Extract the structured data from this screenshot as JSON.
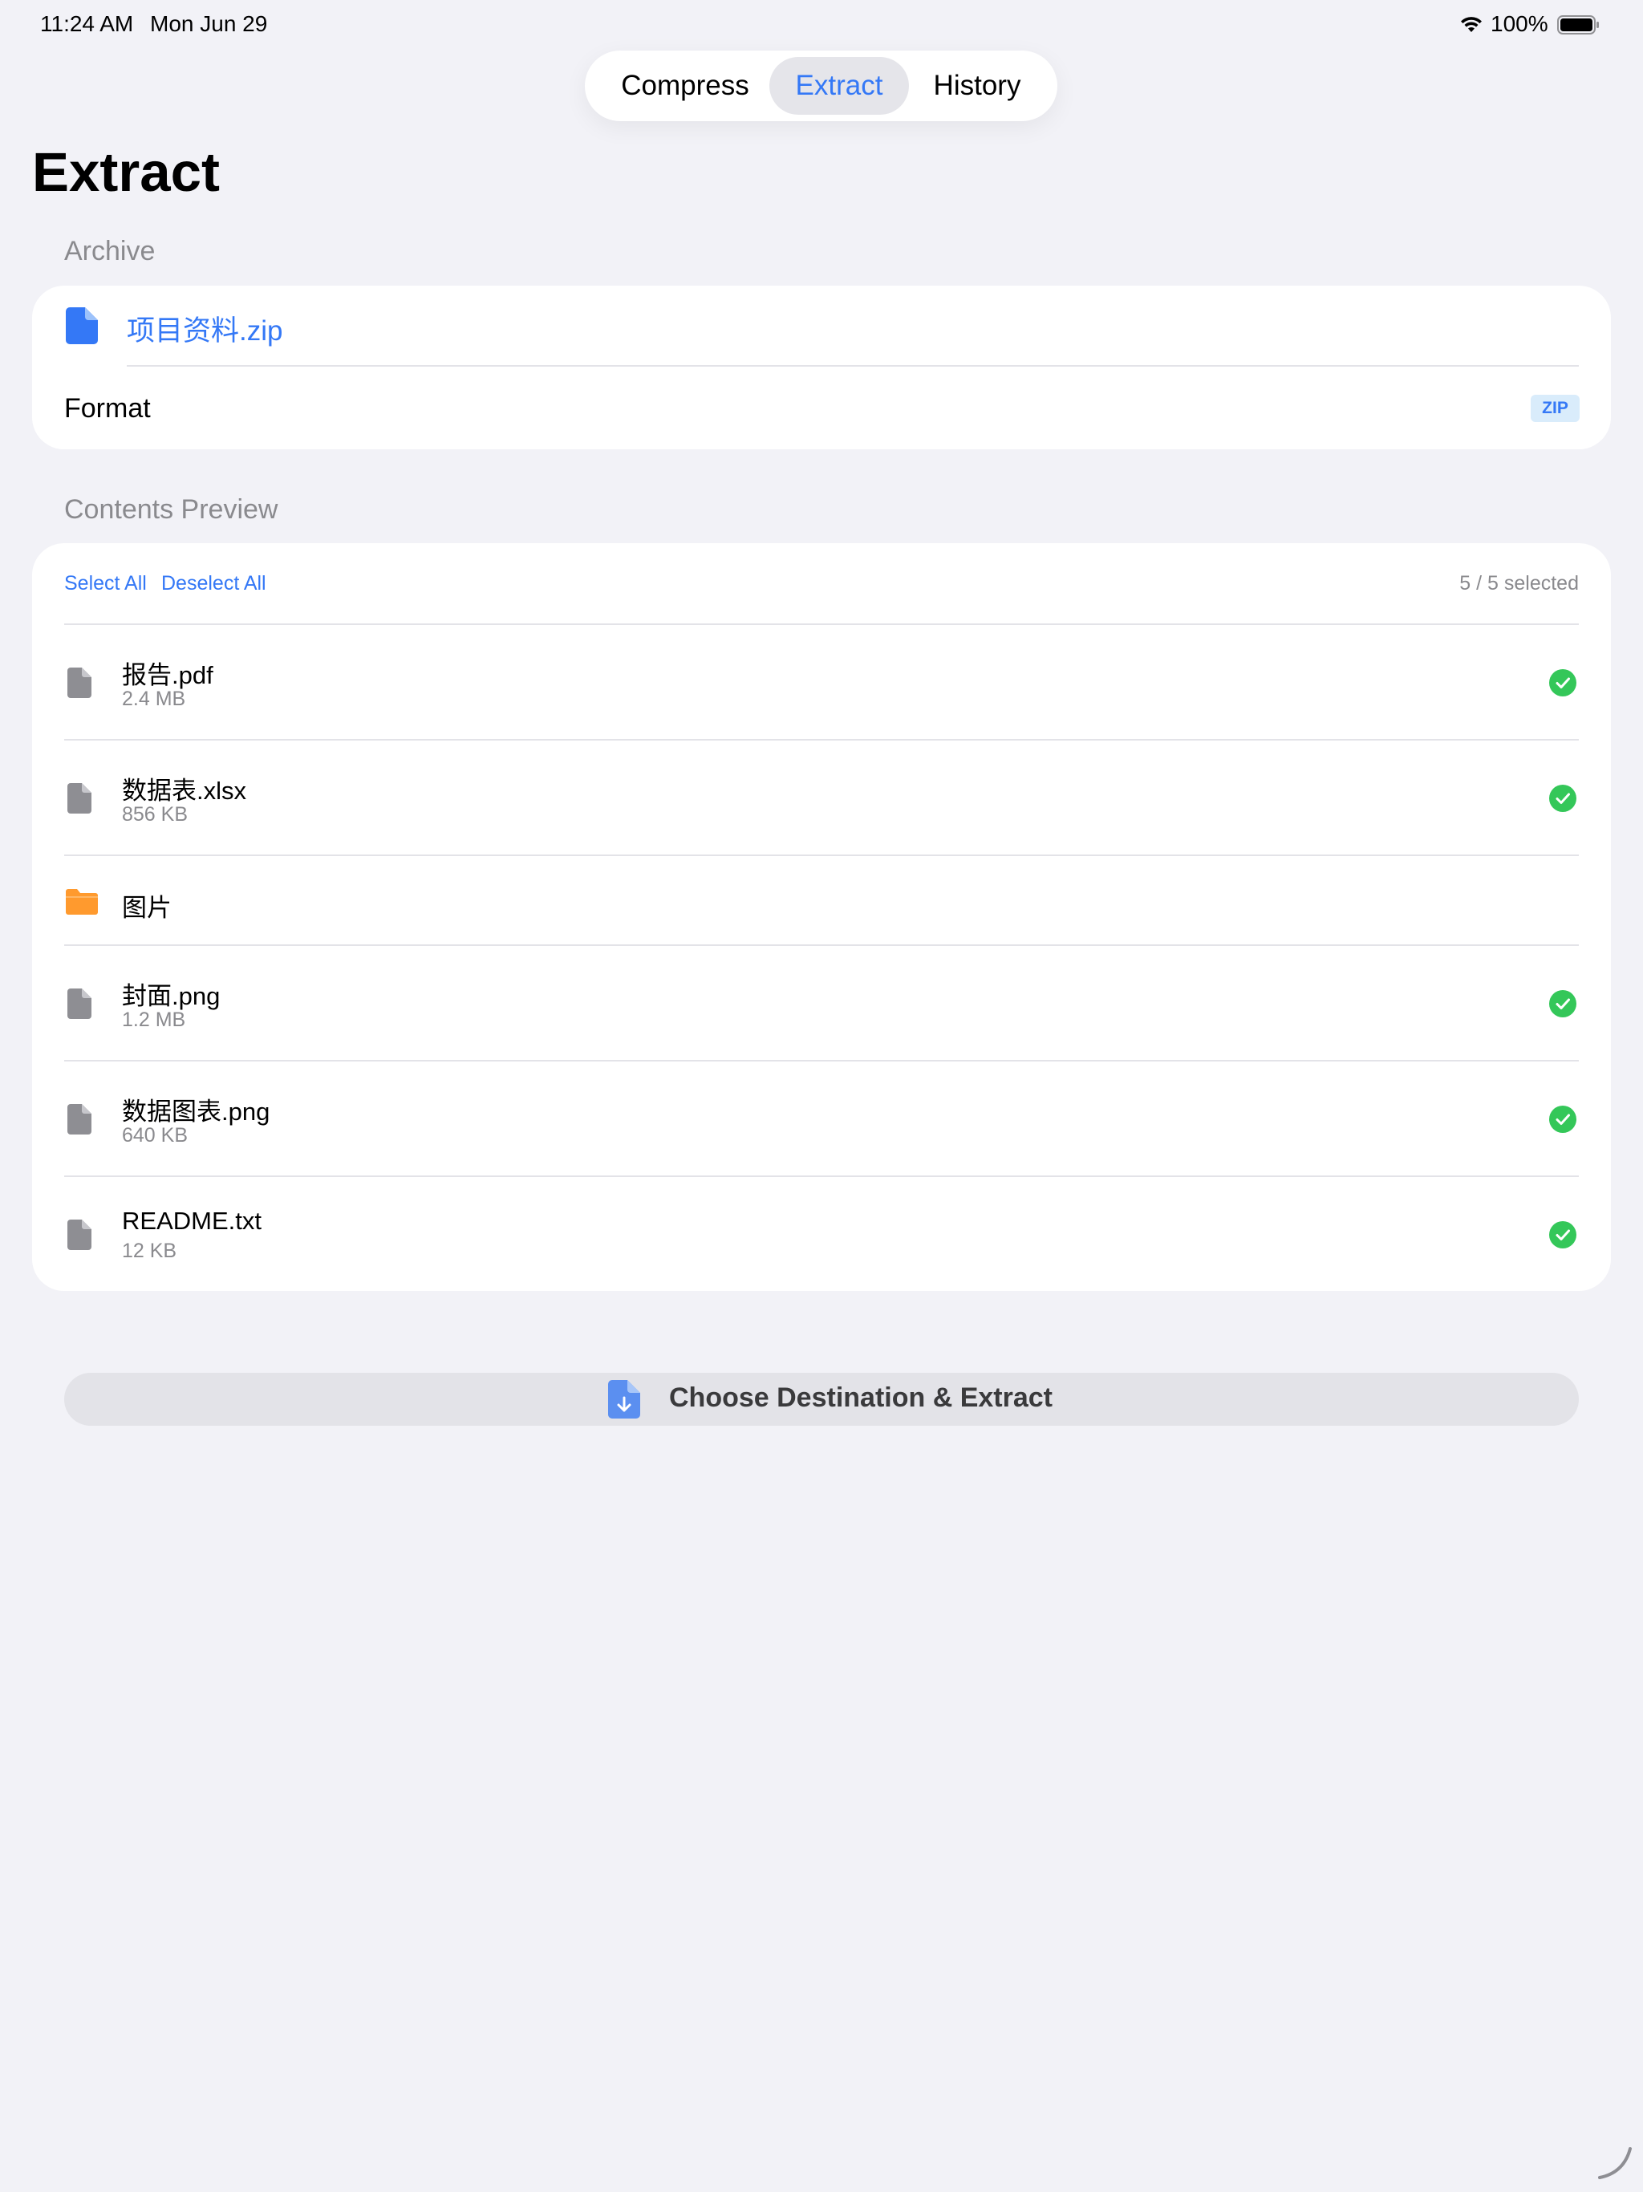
{
  "status_bar": {
    "time": "11:24 AM",
    "date": "Mon Jun 29",
    "battery_percent": "100%",
    "battery_level": 1.0
  },
  "tabs": [
    {
      "label": "Compress",
      "selected": false
    },
    {
      "label": "Extract",
      "selected": true
    },
    {
      "label": "History",
      "selected": false
    }
  ],
  "page_title": "Extract",
  "archive": {
    "section_label": "Archive",
    "file_name": "项目资料.zip",
    "format_label": "Format",
    "format_value": "ZIP"
  },
  "contents": {
    "section_label": "Contents Preview",
    "select_all_label": "Select All",
    "deselect_all_label": "Deselect All",
    "selection_count": "5 / 5 selected",
    "items": [
      {
        "name": "报告.pdf",
        "size": "2.4 MB",
        "type": "file",
        "selected": true
      },
      {
        "name": "数据表.xlsx",
        "size": "856 KB",
        "type": "file",
        "selected": true
      },
      {
        "name": "图片",
        "size": "",
        "type": "folder",
        "selected": false
      },
      {
        "name": "封面.png",
        "size": "1.2 MB",
        "type": "file",
        "selected": true
      },
      {
        "name": "数据图表.png",
        "size": "640 KB",
        "type": "file",
        "selected": true
      },
      {
        "name": "README.txt",
        "size": "12 KB",
        "type": "file",
        "selected": true
      }
    ]
  },
  "extract_button_label": "Choose Destination & Extract",
  "icons": {
    "archive_file": "doc-fill-icon",
    "file": "doc-icon",
    "folder": "folder-icon",
    "checkmark": "checkmark-circle-icon",
    "extract": "doc-arrow-down-icon"
  },
  "colors": {
    "accent": "#3478f6",
    "check_green": "#34c759",
    "folder_orange": "#ff9a2e",
    "file_gray": "#8e8e93",
    "background": "#f2f2f7"
  }
}
